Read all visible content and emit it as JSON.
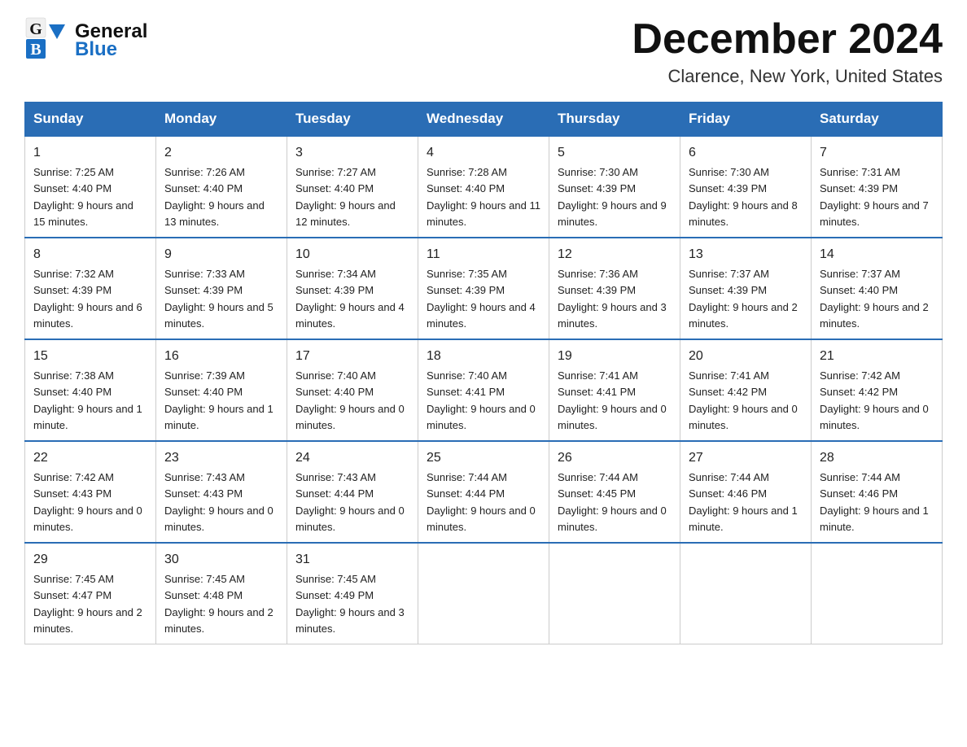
{
  "header": {
    "month_title": "December 2024",
    "location": "Clarence, New York, United States",
    "logo_top": "General",
    "logo_bottom": "Blue"
  },
  "days_of_week": [
    "Sunday",
    "Monday",
    "Tuesday",
    "Wednesday",
    "Thursday",
    "Friday",
    "Saturday"
  ],
  "weeks": [
    [
      {
        "day": "1",
        "sunrise": "7:25 AM",
        "sunset": "4:40 PM",
        "daylight": "9 hours and 15 minutes."
      },
      {
        "day": "2",
        "sunrise": "7:26 AM",
        "sunset": "4:40 PM",
        "daylight": "9 hours and 13 minutes."
      },
      {
        "day": "3",
        "sunrise": "7:27 AM",
        "sunset": "4:40 PM",
        "daylight": "9 hours and 12 minutes."
      },
      {
        "day": "4",
        "sunrise": "7:28 AM",
        "sunset": "4:40 PM",
        "daylight": "9 hours and 11 minutes."
      },
      {
        "day": "5",
        "sunrise": "7:30 AM",
        "sunset": "4:39 PM",
        "daylight": "9 hours and 9 minutes."
      },
      {
        "day": "6",
        "sunrise": "7:30 AM",
        "sunset": "4:39 PM",
        "daylight": "9 hours and 8 minutes."
      },
      {
        "day": "7",
        "sunrise": "7:31 AM",
        "sunset": "4:39 PM",
        "daylight": "9 hours and 7 minutes."
      }
    ],
    [
      {
        "day": "8",
        "sunrise": "7:32 AM",
        "sunset": "4:39 PM",
        "daylight": "9 hours and 6 minutes."
      },
      {
        "day": "9",
        "sunrise": "7:33 AM",
        "sunset": "4:39 PM",
        "daylight": "9 hours and 5 minutes."
      },
      {
        "day": "10",
        "sunrise": "7:34 AM",
        "sunset": "4:39 PM",
        "daylight": "9 hours and 4 minutes."
      },
      {
        "day": "11",
        "sunrise": "7:35 AM",
        "sunset": "4:39 PM",
        "daylight": "9 hours and 4 minutes."
      },
      {
        "day": "12",
        "sunrise": "7:36 AM",
        "sunset": "4:39 PM",
        "daylight": "9 hours and 3 minutes."
      },
      {
        "day": "13",
        "sunrise": "7:37 AM",
        "sunset": "4:39 PM",
        "daylight": "9 hours and 2 minutes."
      },
      {
        "day": "14",
        "sunrise": "7:37 AM",
        "sunset": "4:40 PM",
        "daylight": "9 hours and 2 minutes."
      }
    ],
    [
      {
        "day": "15",
        "sunrise": "7:38 AM",
        "sunset": "4:40 PM",
        "daylight": "9 hours and 1 minute."
      },
      {
        "day": "16",
        "sunrise": "7:39 AM",
        "sunset": "4:40 PM",
        "daylight": "9 hours and 1 minute."
      },
      {
        "day": "17",
        "sunrise": "7:40 AM",
        "sunset": "4:40 PM",
        "daylight": "9 hours and 0 minutes."
      },
      {
        "day": "18",
        "sunrise": "7:40 AM",
        "sunset": "4:41 PM",
        "daylight": "9 hours and 0 minutes."
      },
      {
        "day": "19",
        "sunrise": "7:41 AM",
        "sunset": "4:41 PM",
        "daylight": "9 hours and 0 minutes."
      },
      {
        "day": "20",
        "sunrise": "7:41 AM",
        "sunset": "4:42 PM",
        "daylight": "9 hours and 0 minutes."
      },
      {
        "day": "21",
        "sunrise": "7:42 AM",
        "sunset": "4:42 PM",
        "daylight": "9 hours and 0 minutes."
      }
    ],
    [
      {
        "day": "22",
        "sunrise": "7:42 AM",
        "sunset": "4:43 PM",
        "daylight": "9 hours and 0 minutes."
      },
      {
        "day": "23",
        "sunrise": "7:43 AM",
        "sunset": "4:43 PM",
        "daylight": "9 hours and 0 minutes."
      },
      {
        "day": "24",
        "sunrise": "7:43 AM",
        "sunset": "4:44 PM",
        "daylight": "9 hours and 0 minutes."
      },
      {
        "day": "25",
        "sunrise": "7:44 AM",
        "sunset": "4:44 PM",
        "daylight": "9 hours and 0 minutes."
      },
      {
        "day": "26",
        "sunrise": "7:44 AM",
        "sunset": "4:45 PM",
        "daylight": "9 hours and 0 minutes."
      },
      {
        "day": "27",
        "sunrise": "7:44 AM",
        "sunset": "4:46 PM",
        "daylight": "9 hours and 1 minute."
      },
      {
        "day": "28",
        "sunrise": "7:44 AM",
        "sunset": "4:46 PM",
        "daylight": "9 hours and 1 minute."
      }
    ],
    [
      {
        "day": "29",
        "sunrise": "7:45 AM",
        "sunset": "4:47 PM",
        "daylight": "9 hours and 2 minutes."
      },
      {
        "day": "30",
        "sunrise": "7:45 AM",
        "sunset": "4:48 PM",
        "daylight": "9 hours and 2 minutes."
      },
      {
        "day": "31",
        "sunrise": "7:45 AM",
        "sunset": "4:49 PM",
        "daylight": "9 hours and 3 minutes."
      },
      null,
      null,
      null,
      null
    ]
  ]
}
